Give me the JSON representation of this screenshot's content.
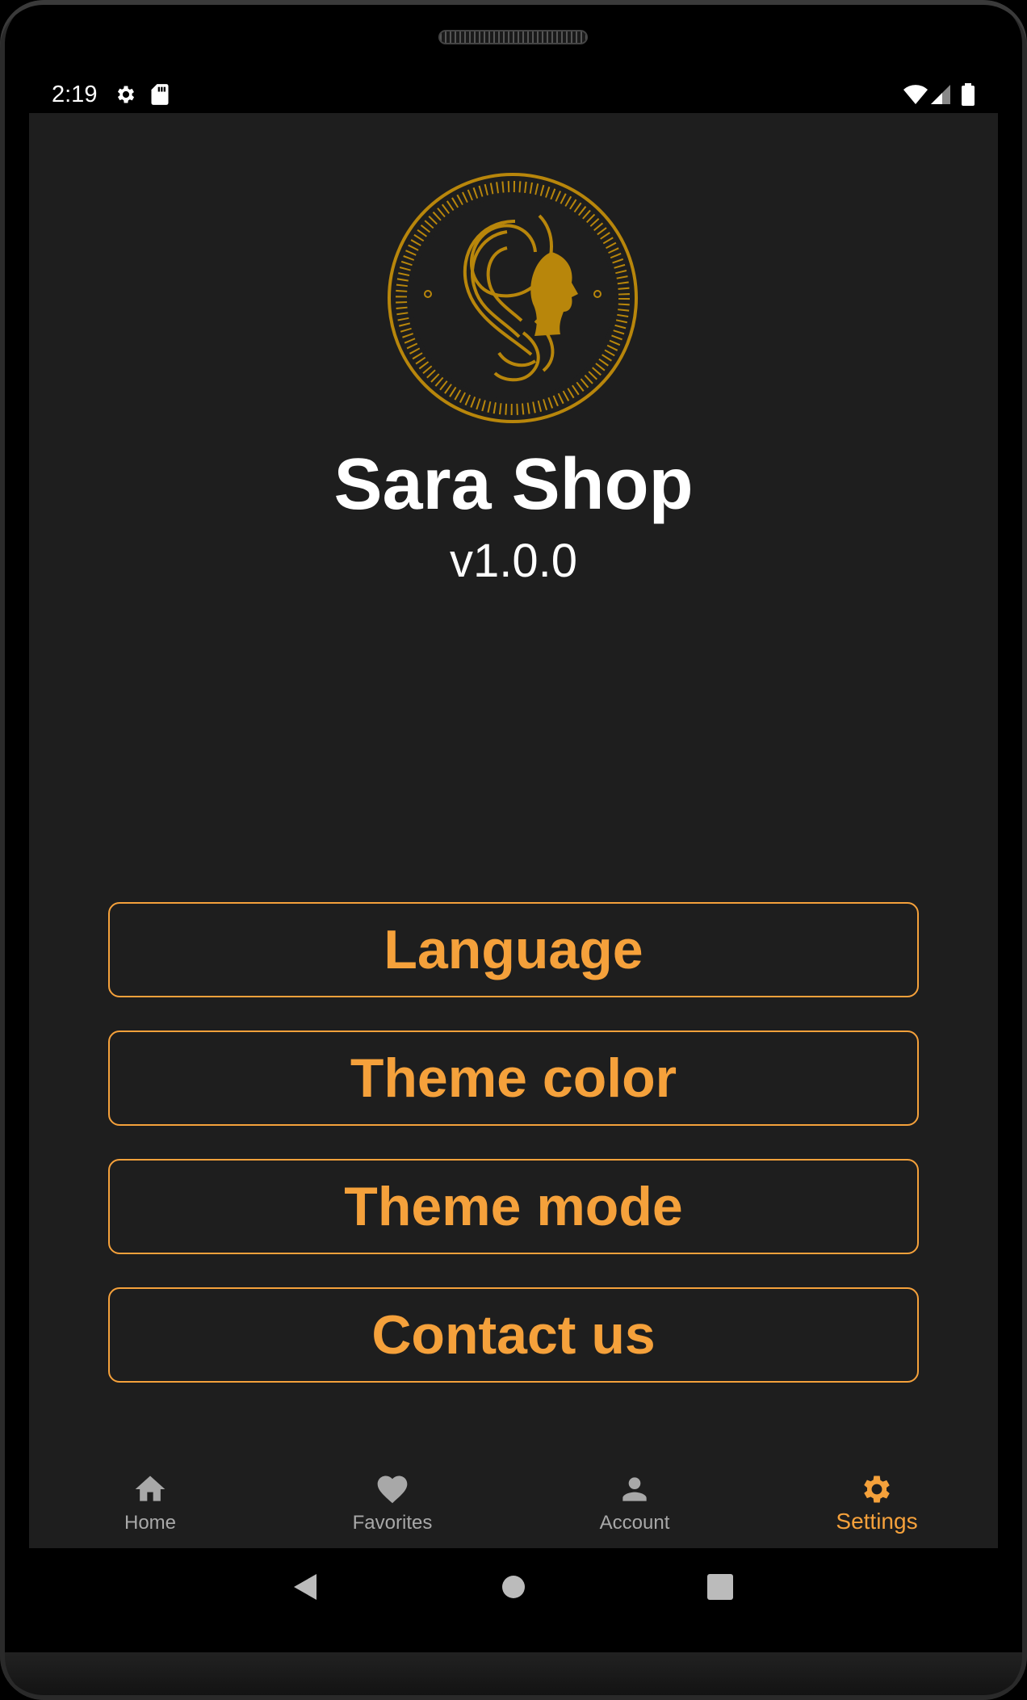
{
  "status_bar": {
    "time": "2:19",
    "icons": [
      "settings-icon",
      "sd-card-icon",
      "wifi-icon",
      "signal-icon",
      "battery-icon"
    ]
  },
  "app": {
    "title": "Sara Shop",
    "version": "v1.0.0",
    "logo": "sara-shop-logo"
  },
  "menu": {
    "items": [
      {
        "label": "Language"
      },
      {
        "label": "Theme color"
      },
      {
        "label": "Theme mode"
      },
      {
        "label": "Contact us"
      }
    ]
  },
  "bottom_nav": {
    "items": [
      {
        "label": "Home",
        "icon": "home-icon"
      },
      {
        "label": "Favorites",
        "icon": "heart-icon"
      },
      {
        "label": "Account",
        "icon": "person-icon"
      },
      {
        "label": "Settings",
        "icon": "gear-icon",
        "active": true
      }
    ]
  },
  "system_nav": {
    "buttons": [
      "back-icon",
      "home-circle-icon",
      "recents-icon"
    ]
  },
  "colors": {
    "accent": "#f5a13b",
    "background": "#1e1e1e",
    "logo_gold": "#b8860b",
    "inactive": "#a8a8a8"
  }
}
